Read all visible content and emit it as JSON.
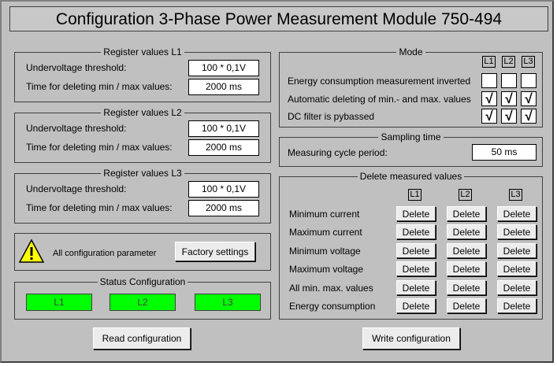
{
  "title": "Configuration 3-Phase Power Measurement Module  750-494",
  "registers": [
    {
      "title": "Register values L1",
      "undervoltage_label": "Undervoltage threshold:",
      "undervoltage_value": "100 * 0,1V",
      "deleting_label": "Time for deleting min / max values:",
      "deleting_value": "2000 ms"
    },
    {
      "title": "Register values L2",
      "undervoltage_label": "Undervoltage threshold:",
      "undervoltage_value": "100 * 0,1V",
      "deleting_label": "Time for deleting min / max values:",
      "deleting_value": "2000 ms"
    },
    {
      "title": "Register values L3",
      "undervoltage_label": "Undervoltage threshold:",
      "undervoltage_value": "100 * 0,1V",
      "deleting_label": "Time for deleting min / max values:",
      "deleting_value": "2000 ms"
    }
  ],
  "factory": {
    "text": "All configuration parameter",
    "button": "Factory settings"
  },
  "status": {
    "title": "Status Configuration",
    "leds": [
      "L1",
      "L2",
      "L3"
    ],
    "color": "#00ff00"
  },
  "mode": {
    "title": "Mode",
    "columns": [
      "L1",
      "L2",
      "L3"
    ],
    "rows": [
      {
        "label": "Energy consumption measurement inverted",
        "checks": [
          "",
          "",
          ""
        ]
      },
      {
        "label": "Automatic deleting of min.- and max. values",
        "checks": [
          "√",
          "√",
          "√"
        ]
      },
      {
        "label": "DC filter is pybassed",
        "checks": [
          "√",
          "√",
          "√"
        ]
      }
    ]
  },
  "sampling": {
    "title": "Sampling time",
    "label": "Measuring cycle period:",
    "value": "50 ms"
  },
  "delete": {
    "title": "Delete measured values",
    "columns": [
      "L1",
      "L2",
      "L3"
    ],
    "button_label": "Delete",
    "rows": [
      "Minimum current",
      "Maximum current",
      "Minimum voltage",
      "Maximum voltage",
      "All min. max. values",
      "Energy consumption"
    ]
  },
  "buttons": {
    "read": "Read configuration",
    "write": "Write configuration"
  }
}
